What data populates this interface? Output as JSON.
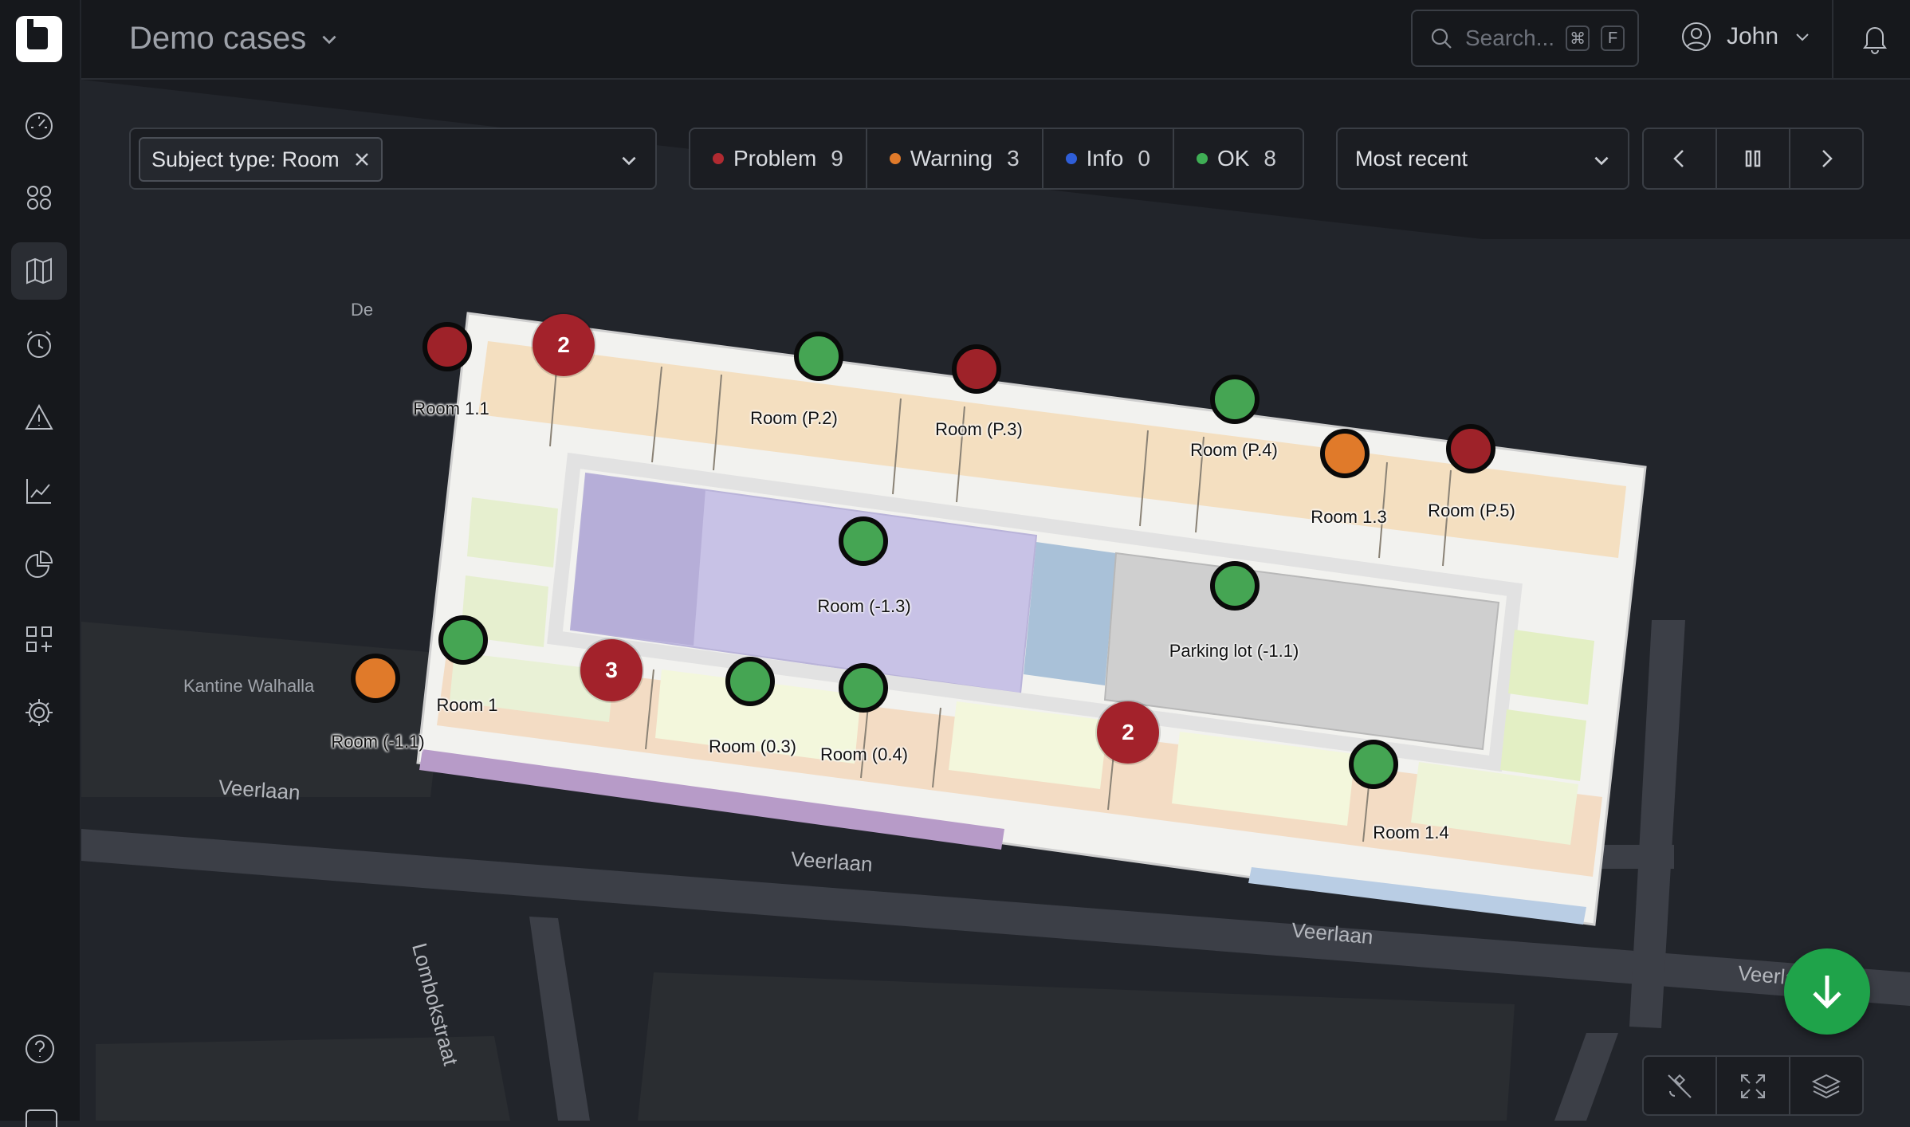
{
  "header": {
    "project": "Demo cases",
    "search_placeholder": "Search...",
    "search_keys": [
      "⌘",
      "F"
    ],
    "user_name": "John"
  },
  "filters": {
    "subject_chip": "Subject type: Room",
    "statuses": [
      {
        "label": "Problem",
        "count": "9",
        "color": "#b12a31"
      },
      {
        "label": "Warning",
        "count": "3",
        "color": "#e07a2a"
      },
      {
        "label": "Info",
        "count": "0",
        "color": "#2f5ed8"
      },
      {
        "label": "OK",
        "count": "8",
        "color": "#3fae55"
      }
    ],
    "sort": "Most recent"
  },
  "map": {
    "streets": [
      "Veerlaan",
      "Veerlaan",
      "Veerlaan",
      "Veerlaan",
      "Lombokstraat",
      "Kantine Walhalla",
      "De"
    ],
    "room_labels": [
      "Room 1.1",
      "Room (P.2)",
      "Room (P.3)",
      "Room (P.4)",
      "Room 1.3",
      "Room (P.5)",
      "Room (-1.3)",
      "Parking lot (-1.1)",
      "Room 1",
      "Room (-1.1)",
      "Room (0.3)",
      "Room (0.4)",
      "Room 1.4"
    ],
    "clusters": [
      "2",
      "3",
      "2"
    ]
  },
  "colors": {
    "problem": "#9e2229",
    "warning": "#e07a2a",
    "ok": "#45a553"
  }
}
